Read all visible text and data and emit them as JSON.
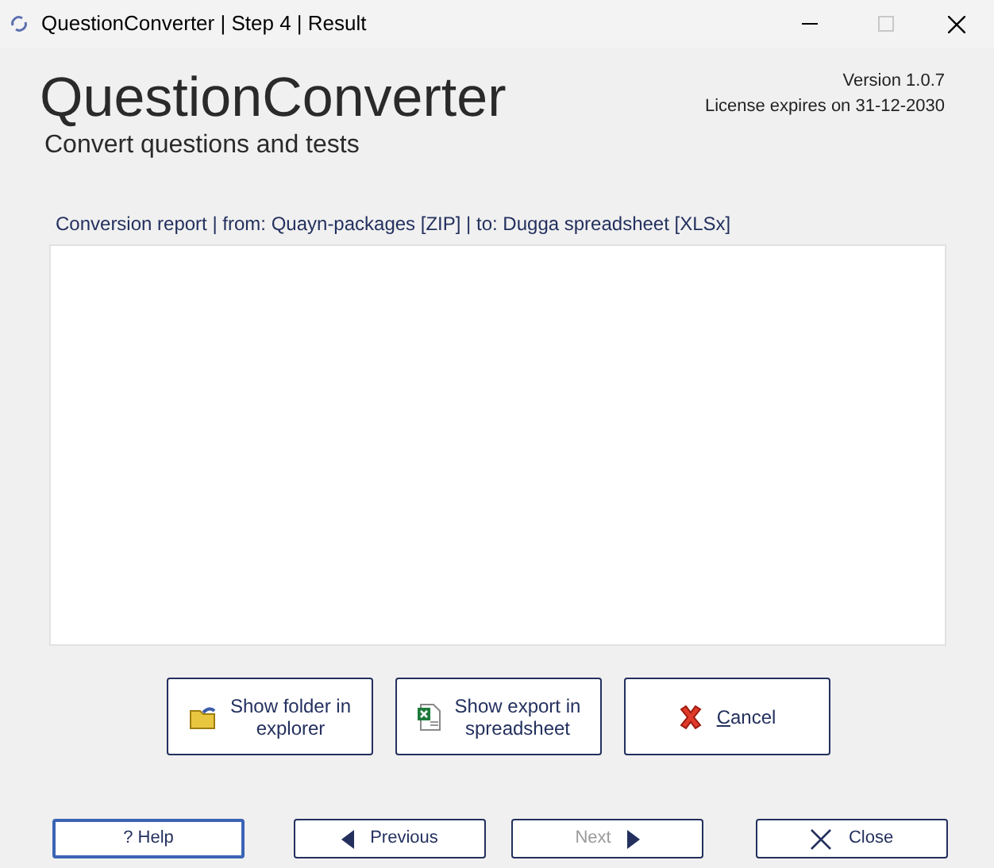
{
  "window": {
    "title": "QuestionConverter | Step 4 | Result"
  },
  "header": {
    "app_name": "QuestionConverter",
    "tagline": "Convert questions and tests",
    "version": "Version 1.0.7",
    "license": "License expires on 31-12-2030"
  },
  "report": {
    "label": "Conversion report | from: Quayn-packages [ZIP] | to: Dugga spreadsheet [XLSx]"
  },
  "actions": [
    {
      "kind": "folder",
      "lines": [
        "Show folder in",
        "explorer"
      ],
      "underline_first": false
    },
    {
      "kind": "spreadsheet",
      "lines": [
        "Show export in",
        "spreadsheet"
      ],
      "underline_first": false
    },
    {
      "kind": "cancel",
      "lines": [
        "Cancel"
      ],
      "underline_first": true
    }
  ],
  "nav": [
    {
      "kind": "help",
      "label": "? Help",
      "disabled": false,
      "focused": true
    },
    {
      "kind": "previous",
      "label": "Previous",
      "disabled": false,
      "focused": false
    },
    {
      "kind": "next",
      "label": "Next",
      "disabled": true,
      "focused": false
    },
    {
      "kind": "close",
      "label": "Close",
      "disabled": false,
      "focused": false
    }
  ]
}
